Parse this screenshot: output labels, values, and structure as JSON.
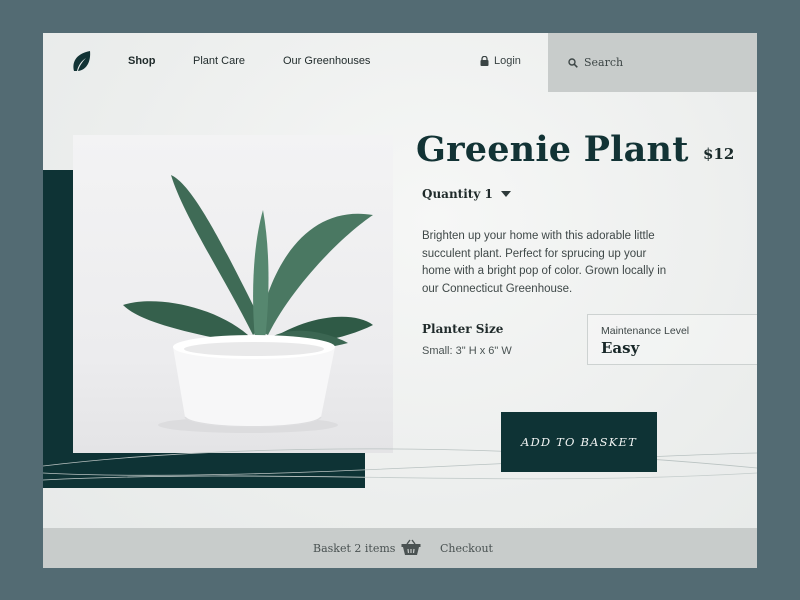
{
  "nav": {
    "logo": "leaf-icon",
    "links": [
      "Shop",
      "Plant Care",
      "Our Greenhouses"
    ],
    "active": "Shop",
    "login_label": "Login",
    "search_placeholder": "Search"
  },
  "product": {
    "title": "Greenie Plant",
    "price": "$12",
    "quantity_label": "Quantity 1",
    "description": "Brighten up your home with this adorable little succulent plant.  Perfect for sprucing up your home with a bright pop of color. Grown locally in our Connecticut Greenhouse.",
    "planter_size_label": "Planter Size",
    "planter_size_value": "Small: 3\" H x 6\" W",
    "maintenance_label": "Maintenance Level",
    "maintenance_value": "Easy",
    "add_button": "ADD TO BASKET",
    "image": "succulent-plant-photo"
  },
  "footer": {
    "basket_label": "Basket 2 items",
    "basket_icon": "basket-icon",
    "checkout_label": "Checkout"
  },
  "colors": {
    "brand_dark": "#0e3335",
    "background": "#536b73",
    "bar_gray": "#c8cccb"
  }
}
